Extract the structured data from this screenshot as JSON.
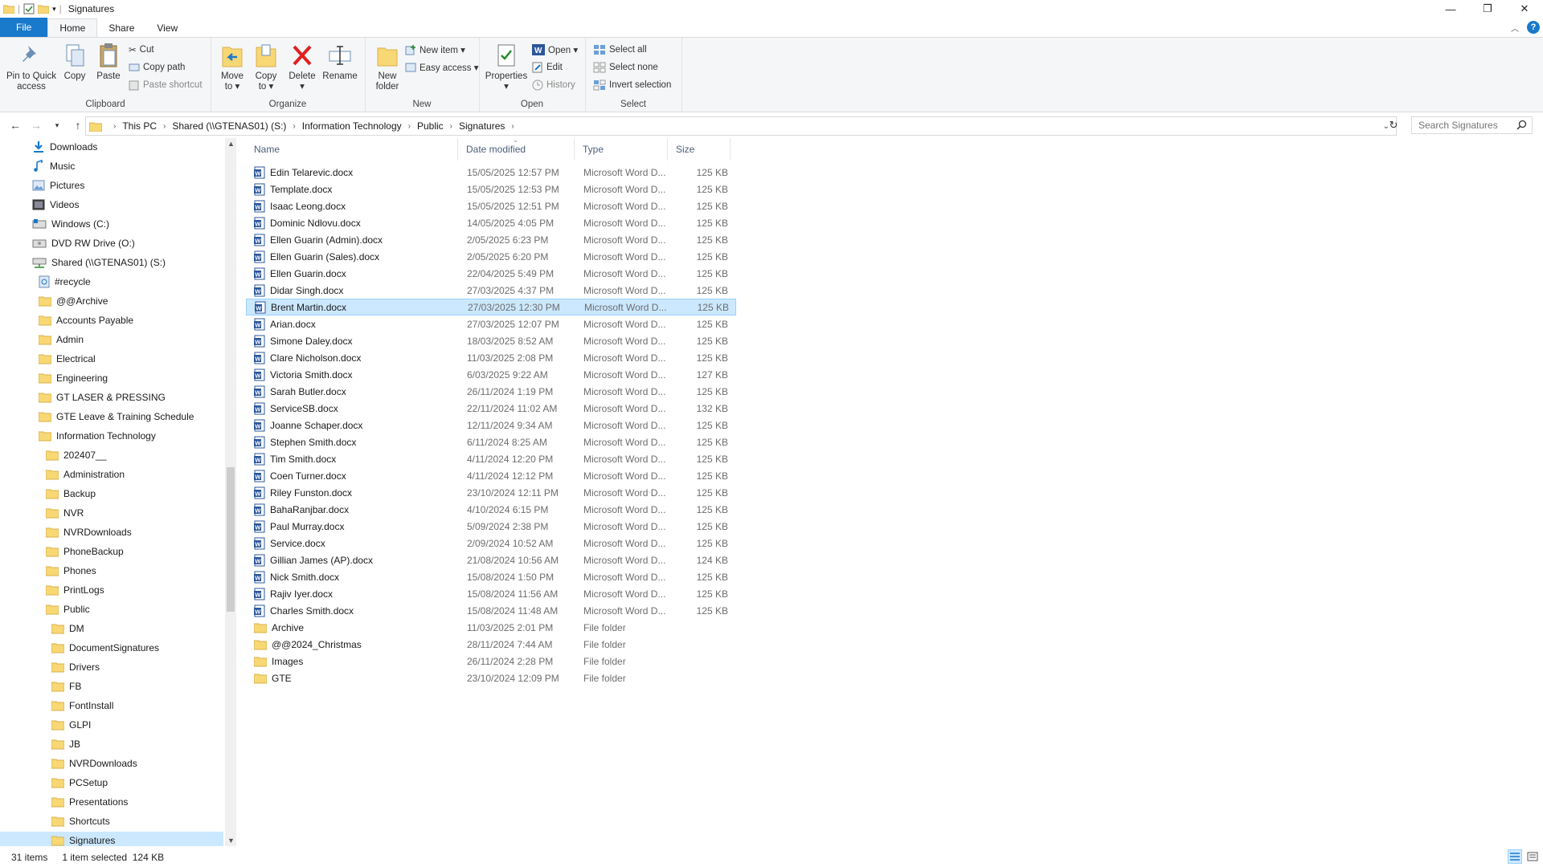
{
  "window": {
    "title": "Signatures",
    "controls": {
      "minimize": "—",
      "maximize": "❐",
      "close": "✕"
    }
  },
  "ribbon_tabs": {
    "file": "File",
    "home": "Home",
    "share": "Share",
    "view": "View"
  },
  "ribbon": {
    "clipboard": {
      "label": "Clipboard",
      "pin": [
        "Pin to Quick",
        "access"
      ],
      "copy": "Copy",
      "paste": "Paste",
      "cut": "Cut",
      "copy_path": "Copy path",
      "paste_shortcut": "Paste shortcut"
    },
    "organize": {
      "label": "Organize",
      "move_to": [
        "Move",
        "to ▾"
      ],
      "copy_to": [
        "Copy",
        "to ▾"
      ],
      "delete": [
        "Delete",
        "▾"
      ],
      "rename": "Rename"
    },
    "new": {
      "label": "New",
      "new_folder": [
        "New",
        "folder"
      ],
      "new_item": "New item ▾",
      "easy_access": "Easy access ▾"
    },
    "open": {
      "label": "Open",
      "properties": [
        "Properties",
        "▾"
      ],
      "open": "Open ▾",
      "edit": "Edit",
      "history": "History"
    },
    "select": {
      "label": "Select",
      "select_all": "Select all",
      "select_none": "Select none",
      "invert_selection": "Invert selection"
    }
  },
  "address": {
    "crumbs": [
      "This PC",
      "Shared (\\\\GTENAS01) (S:)",
      "Information Technology",
      "Public",
      "Signatures"
    ]
  },
  "search": {
    "placeholder": "Search Signatures"
  },
  "nav_pane": [
    {
      "label": "Downloads",
      "icon": "download-icon",
      "indent": 0
    },
    {
      "label": "Music",
      "icon": "music-icon",
      "indent": 0
    },
    {
      "label": "Pictures",
      "icon": "pictures-icon",
      "indent": 0
    },
    {
      "label": "Videos",
      "icon": "videos-icon",
      "indent": 0
    },
    {
      "label": "Windows (C:)",
      "icon": "drive-icon",
      "indent": 0
    },
    {
      "label": "DVD RW Drive (O:)",
      "icon": "dvd-drive-icon",
      "indent": 0
    },
    {
      "label": "Shared (\\\\GTENAS01) (S:)",
      "icon": "network-drive-icon",
      "indent": 0
    },
    {
      "label": "#recycle",
      "icon": "recycle-folder-icon",
      "indent": 1
    },
    {
      "label": "@@Archive",
      "icon": "folder-icon",
      "indent": 1
    },
    {
      "label": "Accounts Payable",
      "icon": "folder-icon",
      "indent": 1
    },
    {
      "label": "Admin",
      "icon": "folder-icon",
      "indent": 1
    },
    {
      "label": "Electrical",
      "icon": "folder-icon",
      "indent": 1
    },
    {
      "label": "Engineering",
      "icon": "folder-icon",
      "indent": 1
    },
    {
      "label": "GT LASER & PRESSING",
      "icon": "folder-icon",
      "indent": 1
    },
    {
      "label": "GTE Leave & Training Schedule",
      "icon": "folder-icon",
      "indent": 1
    },
    {
      "label": "Information Technology",
      "icon": "folder-icon",
      "indent": 1
    },
    {
      "label": "202407__",
      "icon": "folder-icon",
      "indent": 2
    },
    {
      "label": "Administration",
      "icon": "folder-icon",
      "indent": 2
    },
    {
      "label": "Backup",
      "icon": "folder-icon",
      "indent": 2
    },
    {
      "label": "NVR",
      "icon": "folder-icon",
      "indent": 2
    },
    {
      "label": "NVRDownloads",
      "icon": "folder-icon",
      "indent": 2
    },
    {
      "label": "PhoneBackup",
      "icon": "folder-icon",
      "indent": 2
    },
    {
      "label": "Phones",
      "icon": "folder-icon",
      "indent": 2
    },
    {
      "label": "PrintLogs",
      "icon": "folder-icon",
      "indent": 2
    },
    {
      "label": "Public",
      "icon": "folder-icon",
      "indent": 2
    },
    {
      "label": "DM",
      "icon": "folder-icon",
      "indent": 3
    },
    {
      "label": "DocumentSignatures",
      "icon": "folder-icon",
      "indent": 3
    },
    {
      "label": "Drivers",
      "icon": "folder-icon",
      "indent": 3
    },
    {
      "label": "FB",
      "icon": "folder-icon",
      "indent": 3
    },
    {
      "label": "FontInstall",
      "icon": "folder-icon",
      "indent": 3
    },
    {
      "label": "GLPI",
      "icon": "folder-icon",
      "indent": 3
    },
    {
      "label": "JB",
      "icon": "folder-icon",
      "indent": 3
    },
    {
      "label": "NVRDownloads",
      "icon": "folder-icon",
      "indent": 3
    },
    {
      "label": "PCSetup",
      "icon": "folder-icon",
      "indent": 3
    },
    {
      "label": "Presentations",
      "icon": "folder-icon",
      "indent": 3
    },
    {
      "label": "Shortcuts",
      "icon": "folder-icon",
      "indent": 3
    },
    {
      "label": "Signatures",
      "icon": "folder-icon",
      "indent": 3,
      "selected": true
    }
  ],
  "columns": {
    "name": "Name",
    "date": "Date modified",
    "type": "Type",
    "size": "Size"
  },
  "files": [
    {
      "name": "Edin Telarevic.docx",
      "date": "15/05/2025 12:57 PM",
      "type": "Microsoft Word D...",
      "size": "125 KB",
      "kind": "docx"
    },
    {
      "name": "Template.docx",
      "date": "15/05/2025 12:53 PM",
      "type": "Microsoft Word D...",
      "size": "125 KB",
      "kind": "docx"
    },
    {
      "name": "Isaac Leong.docx",
      "date": "15/05/2025 12:51 PM",
      "type": "Microsoft Word D...",
      "size": "125 KB",
      "kind": "docx"
    },
    {
      "name": "Dominic Ndlovu.docx",
      "date": "14/05/2025 4:05 PM",
      "type": "Microsoft Word D...",
      "size": "125 KB",
      "kind": "docx"
    },
    {
      "name": "Ellen Guarin (Admin).docx",
      "date": "2/05/2025 6:23 PM",
      "type": "Microsoft Word D...",
      "size": "125 KB",
      "kind": "docx"
    },
    {
      "name": "Ellen Guarin (Sales).docx",
      "date": "2/05/2025 6:20 PM",
      "type": "Microsoft Word D...",
      "size": "125 KB",
      "kind": "docx"
    },
    {
      "name": "Ellen Guarin.docx",
      "date": "22/04/2025 5:49 PM",
      "type": "Microsoft Word D...",
      "size": "125 KB",
      "kind": "docx"
    },
    {
      "name": "Didar Singh.docx",
      "date": "27/03/2025 4:37 PM",
      "type": "Microsoft Word D...",
      "size": "125 KB",
      "kind": "docx"
    },
    {
      "name": "Brent Martin.docx",
      "date": "27/03/2025 12:30 PM",
      "type": "Microsoft Word D...",
      "size": "125 KB",
      "kind": "docx",
      "selected": true
    },
    {
      "name": "Arian.docx",
      "date": "27/03/2025 12:07 PM",
      "type": "Microsoft Word D...",
      "size": "125 KB",
      "kind": "docx"
    },
    {
      "name": "Simone Daley.docx",
      "date": "18/03/2025 8:52 AM",
      "type": "Microsoft Word D...",
      "size": "125 KB",
      "kind": "docx"
    },
    {
      "name": "Clare Nicholson.docx",
      "date": "11/03/2025 2:08 PM",
      "type": "Microsoft Word D...",
      "size": "125 KB",
      "kind": "docx"
    },
    {
      "name": "Victoria Smith.docx",
      "date": "6/03/2025 9:22 AM",
      "type": "Microsoft Word D...",
      "size": "127 KB",
      "kind": "docx"
    },
    {
      "name": "Sarah Butler.docx",
      "date": "26/11/2024 1:19 PM",
      "type": "Microsoft Word D...",
      "size": "125 KB",
      "kind": "docx"
    },
    {
      "name": "ServiceSB.docx",
      "date": "22/11/2024 11:02 AM",
      "type": "Microsoft Word D...",
      "size": "132 KB",
      "kind": "docx"
    },
    {
      "name": "Joanne Schaper.docx",
      "date": "12/11/2024 9:34 AM",
      "type": "Microsoft Word D...",
      "size": "125 KB",
      "kind": "docx"
    },
    {
      "name": "Stephen Smith.docx",
      "date": "6/11/2024 8:25 AM",
      "type": "Microsoft Word D...",
      "size": "125 KB",
      "kind": "docx"
    },
    {
      "name": "Tim Smith.docx",
      "date": "4/11/2024 12:20 PM",
      "type": "Microsoft Word D...",
      "size": "125 KB",
      "kind": "docx"
    },
    {
      "name": "Coen Turner.docx",
      "date": "4/11/2024 12:12 PM",
      "type": "Microsoft Word D...",
      "size": "125 KB",
      "kind": "docx"
    },
    {
      "name": "Riley Funston.docx",
      "date": "23/10/2024 12:11 PM",
      "type": "Microsoft Word D...",
      "size": "125 KB",
      "kind": "docx"
    },
    {
      "name": "BahaRanjbar.docx",
      "date": "4/10/2024 6:15 PM",
      "type": "Microsoft Word D...",
      "size": "125 KB",
      "kind": "docx"
    },
    {
      "name": "Paul Murray.docx",
      "date": "5/09/2024 2:38 PM",
      "type": "Microsoft Word D...",
      "size": "125 KB",
      "kind": "docx"
    },
    {
      "name": "Service.docx",
      "date": "2/09/2024 10:52 AM",
      "type": "Microsoft Word D...",
      "size": "125 KB",
      "kind": "docx"
    },
    {
      "name": "Gillian James (AP).docx",
      "date": "21/08/2024 10:56 AM",
      "type": "Microsoft Word D...",
      "size": "124 KB",
      "kind": "docx"
    },
    {
      "name": "Nick Smith.docx",
      "date": "15/08/2024 1:50 PM",
      "type": "Microsoft Word D...",
      "size": "125 KB",
      "kind": "docx"
    },
    {
      "name": "Rajiv Iyer.docx",
      "date": "15/08/2024 11:56 AM",
      "type": "Microsoft Word D...",
      "size": "125 KB",
      "kind": "docx"
    },
    {
      "name": "Charles Smith.docx",
      "date": "15/08/2024 11:48 AM",
      "type": "Microsoft Word D...",
      "size": "125 KB",
      "kind": "docx"
    },
    {
      "name": "Archive",
      "date": "11/03/2025 2:01 PM",
      "type": "File folder",
      "size": "",
      "kind": "folder"
    },
    {
      "name": "@@2024_Christmas",
      "date": "28/11/2024 7:44 AM",
      "type": "File folder",
      "size": "",
      "kind": "folder"
    },
    {
      "name": "Images",
      "date": "26/11/2024 2:28 PM",
      "type": "File folder",
      "size": "",
      "kind": "folder"
    },
    {
      "name": "GTE",
      "date": "23/10/2024 12:09 PM",
      "type": "File folder",
      "size": "",
      "kind": "folder"
    }
  ],
  "status": {
    "count": "31 items",
    "selection": "1 item selected  124 KB"
  },
  "colors": {
    "accent": "#1979ca",
    "selection": "#cce8ff",
    "selection_border": "#99d1ff",
    "folder": "#f8d775",
    "word": "#2b579a"
  }
}
